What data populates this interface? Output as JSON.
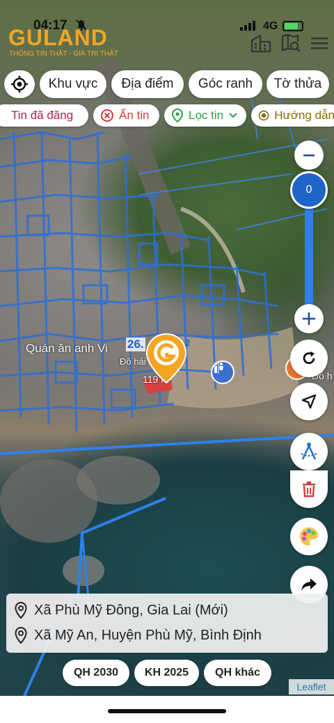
{
  "status": {
    "time": "04:17",
    "network": "4G"
  },
  "brand": {
    "logo": "GULAND",
    "slogan": "THÔNG TIN THẬT - GIÁ TRỊ THẬT"
  },
  "chips_top": [
    "Khu vực",
    "Địa điểm",
    "Góc ranh",
    "Tờ thửa"
  ],
  "chips_filter": {
    "posted": "Tin đã đăng",
    "hidden": "Ẩn tin",
    "filter": "Lọc tin",
    "guide": "Hướng dẫn"
  },
  "zoom": {
    "level": "0"
  },
  "map_labels": {
    "restaurant": "Quán ăn anh Vi",
    "small_label": "Đồ hải sả",
    "area_label": "26.",
    "parcel_area": "119 m²",
    "unit_m2": "2",
    "right_label": "Đồ h"
  },
  "address": {
    "line1": "Xã Phù Mỹ Đông, Gia Lai (Mới)",
    "line2": "Xã Mỹ An, Huyện Phù Mỹ, Bình Định"
  },
  "plan_buttons": [
    "QH 2030",
    "KH 2025",
    "QH khác"
  ],
  "attribution": "Leaflet",
  "colors": {
    "brand": "#f4a623",
    "accent_blue": "#1f73d6",
    "map_line": "#3b82e6",
    "danger": "#d23b3b",
    "filter_green": "#2e9d4a"
  }
}
